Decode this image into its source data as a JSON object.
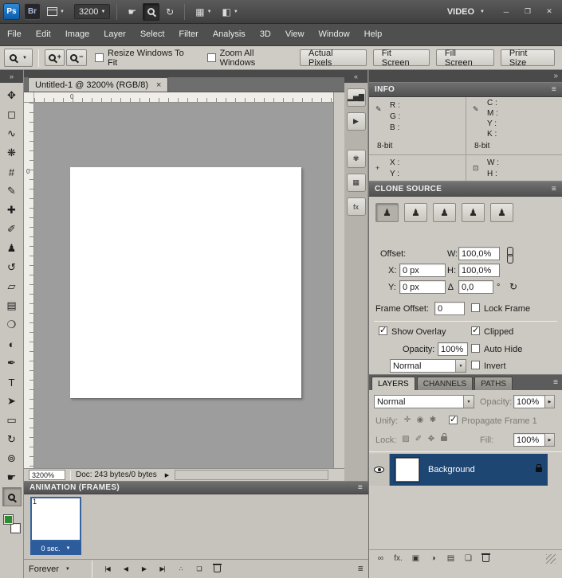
{
  "titlebar": {
    "ps": "Ps",
    "br": "Br",
    "zoom_level": "3200",
    "workspace": "VIDEO",
    "minimize": "─",
    "restore": "❐",
    "close": "✕"
  },
  "icons": {
    "hand": "☛",
    "rotate_view": "↻",
    "arrange_documents": "▦",
    "screen_mode": "◧",
    "panel_menu": "≡",
    "collapse_left": "»",
    "collapse_mid": "«",
    "collapse_right": "»",
    "zoom_in_sign": "+",
    "zoom_out_sign": "−",
    "status_menu": "▶",
    "tab_close": "×",
    "eyedropper": "✎",
    "crosshair": "+",
    "region": "⊡",
    "angle": "∆",
    "degree": "°",
    "reset": "↻",
    "timeline_convert": "≣"
  },
  "menu": [
    {
      "name": "menu-file",
      "label": "File"
    },
    {
      "name": "menu-edit",
      "label": "Edit"
    },
    {
      "name": "menu-image",
      "label": "Image"
    },
    {
      "name": "menu-layer",
      "label": "Layer"
    },
    {
      "name": "menu-select",
      "label": "Select"
    },
    {
      "name": "menu-filter",
      "label": "Filter"
    },
    {
      "name": "menu-analysis",
      "label": "Analysis"
    },
    {
      "name": "menu-3d",
      "label": "3D"
    },
    {
      "name": "menu-view",
      "label": "View"
    },
    {
      "name": "menu-window",
      "label": "Window"
    },
    {
      "name": "menu-help",
      "label": "Help"
    }
  ],
  "options": {
    "resize_windows": "Resize Windows To Fit",
    "zoom_all_windows": "Zoom All Windows",
    "actual_pixels": "Actual Pixels",
    "fit_screen": "Fit Screen",
    "fill_screen": "Fill Screen",
    "print_size": "Print Size"
  },
  "tools": [
    {
      "name": "move-tool",
      "glyph": "✥"
    },
    {
      "name": "rectangular-marquee-tool",
      "glyph": "◻"
    },
    {
      "name": "lasso-tool",
      "glyph": "∿"
    },
    {
      "name": "quick-selection-tool",
      "glyph": "❋"
    },
    {
      "name": "crop-tool",
      "glyph": "#"
    },
    {
      "name": "eyedropper-tool",
      "glyph": "✎"
    },
    {
      "name": "healing-brush-tool",
      "glyph": "✚"
    },
    {
      "name": "brush-tool",
      "glyph": "✐"
    },
    {
      "name": "clone-stamp-tool",
      "glyph": "♟"
    },
    {
      "name": "history-brush-tool",
      "glyph": "↺"
    },
    {
      "name": "eraser-tool",
      "glyph": "▱"
    },
    {
      "name": "gradient-tool",
      "glyph": "▤"
    },
    {
      "name": "blur-tool",
      "glyph": "❍"
    },
    {
      "name": "dodge-tool",
      "glyph": "◐"
    },
    {
      "name": "pen-tool",
      "glyph": "✒"
    },
    {
      "name": "type-tool",
      "glyph": "T"
    },
    {
      "name": "path-selection-tool",
      "glyph": "➤"
    },
    {
      "name": "shape-tool",
      "glyph": "▭"
    },
    {
      "name": "3d-rotate-tool",
      "glyph": "↻"
    },
    {
      "name": "3d-orbit-tool",
      "glyph": "⊚"
    },
    {
      "name": "hand-tool",
      "glyph": "☛"
    },
    {
      "name": "zoom-tool",
      "glyph": "",
      "cls": "mag selected"
    }
  ],
  "dock_icons": [
    {
      "name": "histogram-panel-icon",
      "glyph": "▂▅▇"
    },
    {
      "name": "actions-panel-icon",
      "glyph": "▶"
    },
    {
      "name": "color-panel-icon",
      "glyph": "✾",
      "cls": "gap"
    },
    {
      "name": "swatches-panel-icon",
      "glyph": "▦"
    },
    {
      "name": "styles-panel-icon",
      "glyph": "fx"
    }
  ],
  "document": {
    "tab_title": "Untitled-1 @ 3200% (RGB/8)",
    "ruler_h_zero": "0",
    "ruler_v_zero": "0",
    "zoom_percent": "3200%",
    "doc_info": "Doc: 243 bytes/0 bytes"
  },
  "info": {
    "title": "INFO",
    "r": "R :",
    "g": "G :",
    "b": "B :",
    "c": "C :",
    "m": "M :",
    "y": "Y :",
    "k": "K :",
    "bit_left": "8-bit",
    "bit_right": "8-bit",
    "x": "X :",
    "y2": "Y :",
    "w": "W :",
    "h": "H :"
  },
  "clone_source": {
    "title": "CLONE SOURCE",
    "stamps": [
      {
        "name": "clone-source-1-button",
        "glyph": "♟",
        "cls": "selected"
      },
      {
        "name": "clone-source-2-button",
        "glyph": "♟"
      },
      {
        "name": "clone-source-3-button",
        "glyph": "♟"
      },
      {
        "name": "clone-source-4-button",
        "glyph": "♟"
      },
      {
        "name": "clone-source-5-button",
        "glyph": "♟"
      }
    ],
    "offset_label": "Offset:",
    "w_label": "W:",
    "w_value": "100,0%",
    "x_label": "X:",
    "x_value": "0 px",
    "h_label": "H:",
    "h_value": "100,0%",
    "y_label": "Y:",
    "y_value": "0 px",
    "angle_value": "0,0",
    "frame_offset_label": "Frame Offset:",
    "frame_offset_value": "0",
    "lock_frame_label": "Lock Frame",
    "lock_frame_checked": false,
    "show_overlay_label": "Show Overlay",
    "show_overlay_checked": true,
    "clipped_label": "Clipped",
    "clipped_checked": true,
    "opacity_label": "Opacity:",
    "opacity_value": "100%",
    "auto_hide_label": "Auto Hide",
    "auto_hide_checked": false,
    "blend_mode": "Normal",
    "invert_label": "Invert",
    "invert_checked": false
  },
  "layers": {
    "tabs": [
      {
        "name": "tab-layers",
        "label": "LAYERS",
        "cls": "active"
      },
      {
        "name": "tab-channels",
        "label": "CHANNELS"
      },
      {
        "name": "tab-paths",
        "label": "PATHS"
      }
    ],
    "blend_mode": "Normal",
    "opacity_label": "Opacity:",
    "opacity_value": "100%",
    "unify_label": "Unify:",
    "unify_icons": [
      {
        "name": "unify-position-button",
        "glyph": "✛"
      },
      {
        "name": "unify-visibility-button",
        "glyph": "◉"
      },
      {
        "name": "unify-style-button",
        "glyph": "✱"
      }
    ],
    "propagate_label": "Propagate Frame 1",
    "propagate_checked": true,
    "lock_label": "Lock:",
    "lock_icons": [
      {
        "name": "lock-transparency-button",
        "glyph": "▨"
      },
      {
        "name": "lock-pixels-button",
        "glyph": "✐"
      },
      {
        "name": "lock-position-button",
        "glyph": "✥"
      },
      {
        "name": "lock-all-button",
        "glyph": "",
        "cls": "padlock"
      }
    ],
    "fill_label": "Fill:",
    "fill_value": "100%",
    "layer_name": "Background",
    "bottom_icons": [
      {
        "name": "link-layers-button",
        "glyph": "∞"
      },
      {
        "name": "layer-style-button",
        "glyph": "fx."
      },
      {
        "name": "add-layer-mask-button",
        "glyph": "▣"
      },
      {
        "name": "new-adjustment-layer-button",
        "glyph": "◑"
      },
      {
        "name": "new-group-button",
        "glyph": "▤"
      },
      {
        "name": "new-layer-button",
        "glyph": "❏"
      },
      {
        "name": "delete-layer-button",
        "glyph": "",
        "cls": "trash"
      }
    ]
  },
  "animation": {
    "title": "ANIMATION (FRAMES)",
    "frame_number": "1",
    "frame_delay": "0 sec.",
    "loop_label": "Forever",
    "transport": [
      {
        "name": "first-frame-button",
        "glyph": "|◀"
      },
      {
        "name": "previous-frame-button",
        "glyph": "◀"
      },
      {
        "name": "play-button",
        "glyph": "▶"
      },
      {
        "name": "next-frame-button",
        "glyph": "▶|"
      },
      {
        "name": "tween-button",
        "glyph": "∴"
      },
      {
        "name": "duplicate-frame-button",
        "glyph": "❏"
      },
      {
        "name": "delete-frame-button",
        "glyph": "",
        "cls": "trash"
      }
    ]
  },
  "colors": {
    "foreground_swatch": "#2f8b2f",
    "background_swatch": "#ffffff",
    "selected_layer_row": "#1d4673",
    "frame_delay_bar": "#2d5c9c",
    "panel_background": "#ccc9c2",
    "canvas_background": "#9d9d9d"
  }
}
